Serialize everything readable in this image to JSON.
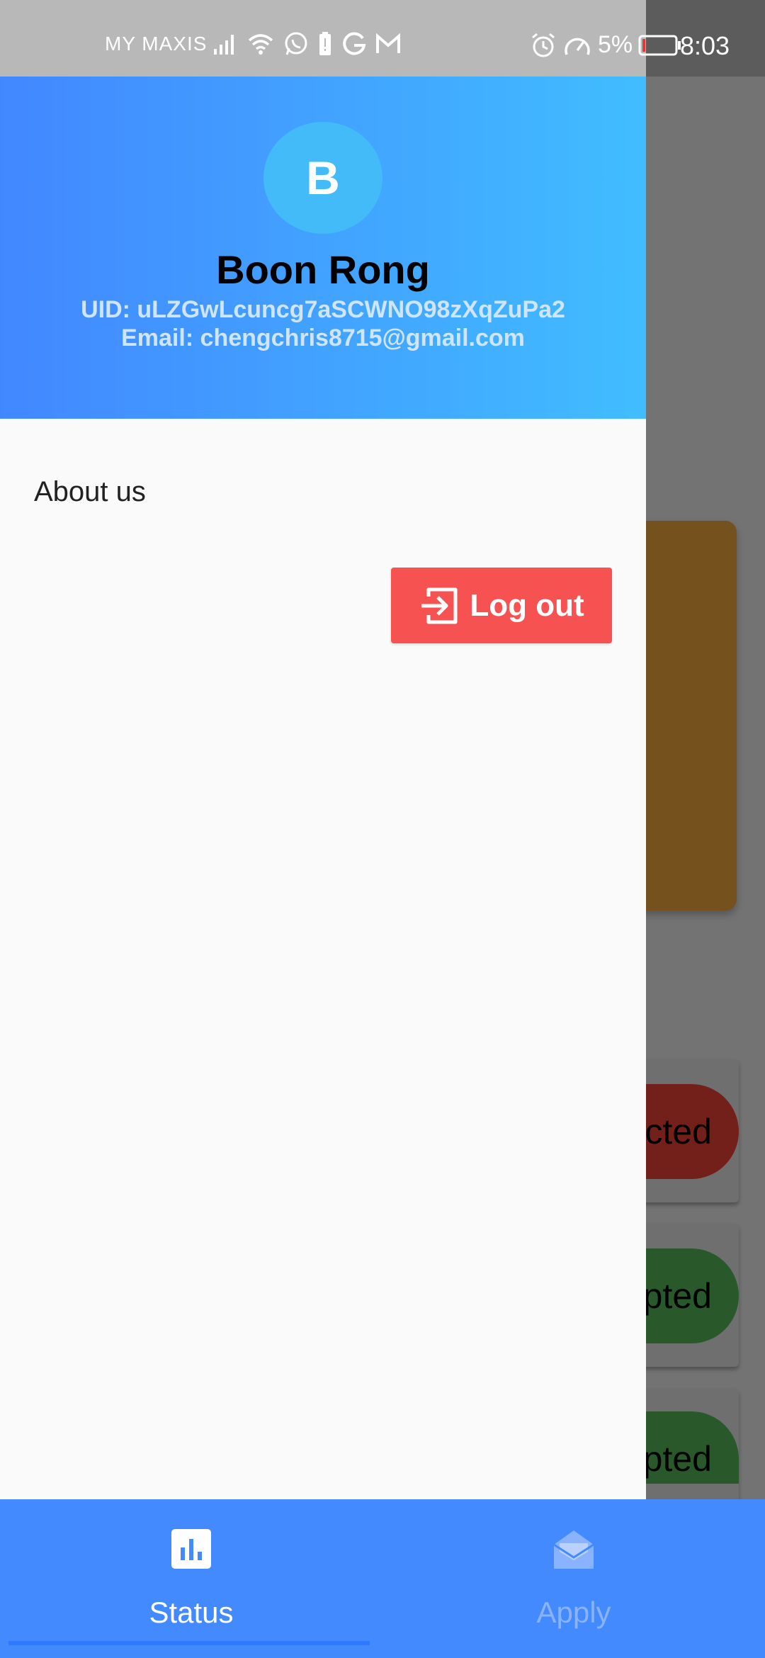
{
  "status_bar": {
    "carrier": "MY MAXIS",
    "battery_percent": "5%",
    "time": "8:03",
    "icons_left": [
      "signal-icon",
      "wifi-icon",
      "whatsapp-icon",
      "battery-alert-icon",
      "g-icon",
      "gmail-icon"
    ],
    "icons_right": [
      "alarm-icon",
      "speedometer-icon"
    ]
  },
  "drawer": {
    "avatar_letter": "B",
    "name": "Boon Rong",
    "uid": "UID: uLZGwLcuncg7aSCWNO98zXqZuPa2",
    "email": "Email: chengchris8715@gmail.com",
    "menu": {
      "about": "About us"
    },
    "logout_label": "Log out"
  },
  "background": {
    "pill_1": "cted",
    "pill_2": "pted",
    "pill_3": "pted"
  },
  "bottom_nav": {
    "items": [
      {
        "label": "Status",
        "icon": "bar-chart-icon",
        "selected": true
      },
      {
        "label": "Apply",
        "icon": "envelope-open-icon",
        "selected": false
      }
    ]
  },
  "colors": {
    "header_gradient_start": "#4287ff",
    "header_gradient_end": "#41bdff",
    "logout_button": "#f75252",
    "bottom_nav": "#438aff"
  }
}
